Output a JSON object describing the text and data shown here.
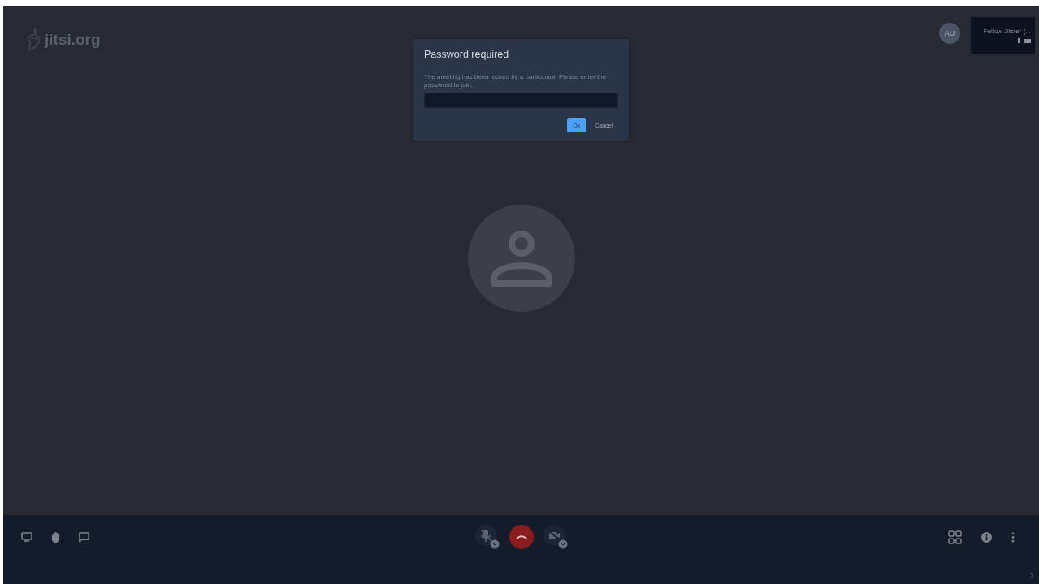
{
  "logo": {
    "text": "jitsi.org"
  },
  "dialog": {
    "title": "Password required",
    "message": "The meeting has been locked by a participant. Please enter the password to join.",
    "buttons": [
      {
        "label": "Ok",
        "kind": "primary"
      },
      {
        "label": "Cancel",
        "kind": "secondary"
      }
    ]
  },
  "local_avatar": {
    "initials": "AU"
  },
  "thumbnail": {
    "name": "Fellow Jitster (..."
  },
  "toolbar": {
    "center": [
      {
        "kind": "mic",
        "muted": true
      },
      {
        "kind": "hangup"
      },
      {
        "kind": "camera",
        "muted": true
      }
    ]
  }
}
